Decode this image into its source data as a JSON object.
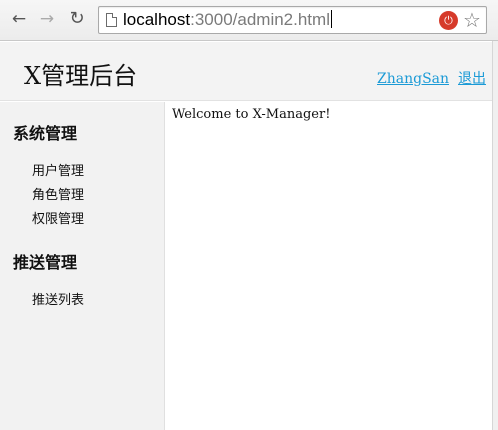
{
  "browser": {
    "url_host": "localhost",
    "url_path": ":3000/admin2.html",
    "icons": {
      "back": "arrow-left-icon",
      "forward": "arrow-right-icon",
      "reload": "reload-icon",
      "page": "page-icon",
      "extension": "extension-icon",
      "bookmark": "star-icon"
    }
  },
  "header": {
    "brand": "X管理后台",
    "user_link": "ZhangSan",
    "logout_link": "退出"
  },
  "sidebar": {
    "groups": [
      {
        "title": "系统管理",
        "items": [
          "用户管理",
          "角色管理",
          "权限管理"
        ]
      },
      {
        "title": "推送管理",
        "items": [
          "推送列表"
        ]
      }
    ]
  },
  "main": {
    "welcome": "Welcome to X-Manager!"
  },
  "colors": {
    "link": "#1a9ad6",
    "sidebar_bg": "#f2f2f2",
    "header_bg": "#f3f3f3",
    "extension": "#d63a2a"
  }
}
